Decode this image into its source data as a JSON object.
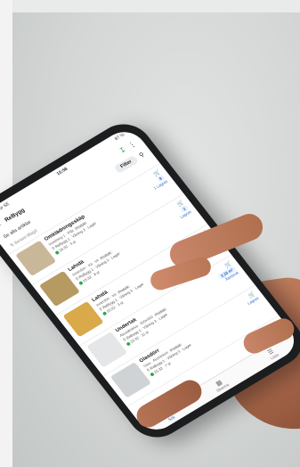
{
  "status_bar": {
    "left": "Telenor SE",
    "time": "15:58",
    "right": "87 %"
  },
  "app_bar": {
    "back_icon": "arrow-left-icon",
    "title": "ReBygg"
  },
  "filter_row": {
    "label": "Se alla artiklar",
    "filter_button": "Filter"
  },
  "sort_row": {
    "label": "Senast tillagd"
  },
  "items": [
    {
      "name": "Omklädningsskåp",
      "meta": "Inredning 1 · Plåt",
      "tag": "Produkt",
      "location": "ReBygg 1 · Våning 3 · Lager",
      "info": "15:32 · 3 st",
      "badge": "8",
      "side": "1 Lagras",
      "thumb_color": "#c9b79a"
    },
    {
      "name": "Lahidä",
      "meta": "Innerdörr · trä · vit",
      "tag": "Produkt",
      "location": "ReBygg 1 · Våning 3 · Lager",
      "info": "15:32 · 8 st",
      "badge": "2",
      "side": "Lagras",
      "thumb_color": "#b69a62"
    },
    {
      "name": "Lahidä",
      "meta": "Innerdörr · trä",
      "tag": "Produkt",
      "location": "ReBygg 1 · Våning 3 · Lager",
      "info": "15:32 · 3 st",
      "badge": "10,8 m²",
      "side": "Återbruk",
      "thumb_color": "#d9a94a"
    },
    {
      "name": "Undertak",
      "meta": "Akustikskiva · 600x600",
      "tag": "Produkt",
      "location": "ReBygg 1 · Våning 3 · Lager",
      "info": "15:32 · 11 st",
      "badge": "2,16 m²",
      "side": "Återbruk",
      "thumb_color": "#e4e6e8"
    },
    {
      "name": "Glasdörr",
      "meta": "Glas · Aluminium",
      "tag": "Produkt",
      "location": "ReBygg 1 · Våning 3 · Lager",
      "info": "15:32 · 7 st",
      "badge": "",
      "side": "Lagras",
      "thumb_color": "#cfd3d6"
    }
  ],
  "bottom_nav": [
    {
      "label": "Sök",
      "icon": "search-icon",
      "active": true
    },
    {
      "label": "Skanna",
      "icon": "qr-icon",
      "active": false
    },
    {
      "label": "Lista",
      "icon": "list-icon",
      "active": false
    }
  ]
}
